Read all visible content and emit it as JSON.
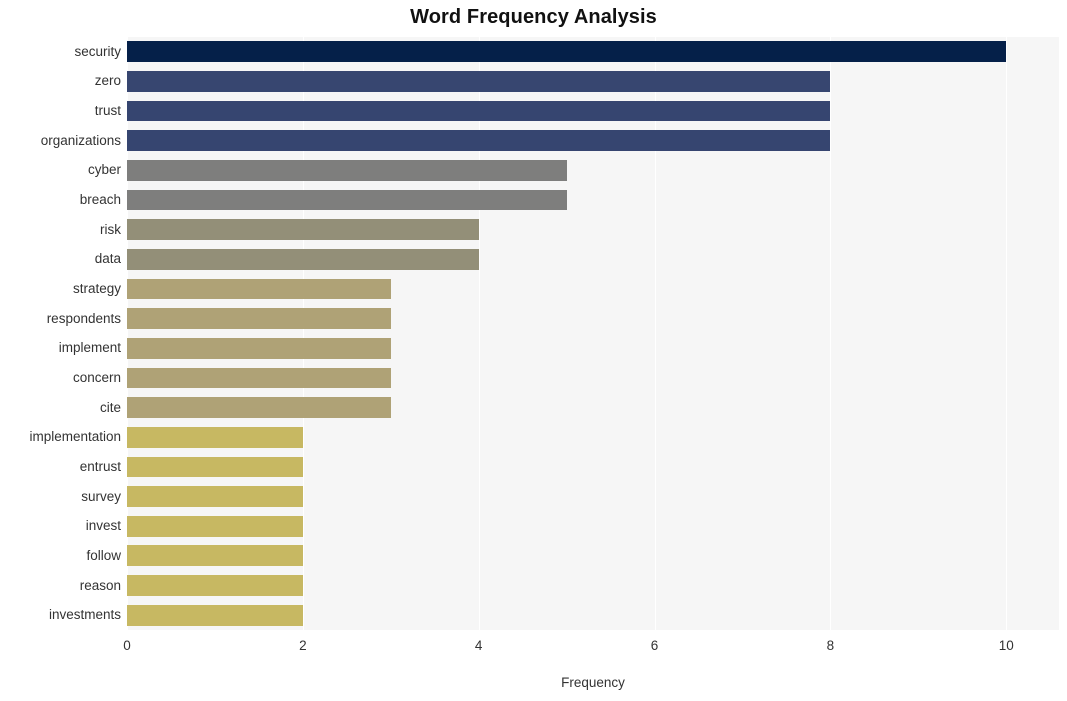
{
  "chart_data": {
    "type": "bar",
    "orientation": "horizontal",
    "title": "Word Frequency Analysis",
    "xlabel": "Frequency",
    "ylabel": "",
    "xlim": [
      0,
      10.6
    ],
    "ylim": null,
    "grid": true,
    "grid_color": "#ffffff",
    "plot_background": "#f6f6f6",
    "figure_background": "#ffffff",
    "legend": null,
    "legend_position": "none",
    "xticks": [
      0,
      2,
      4,
      6,
      8,
      10
    ],
    "xticklabels": [
      "0",
      "2",
      "4",
      "6",
      "8",
      "10"
    ],
    "categories": [
      "security",
      "zero",
      "trust",
      "organizations",
      "cyber",
      "breach",
      "risk",
      "data",
      "strategy",
      "respondents",
      "implement",
      "concern",
      "cite",
      "implementation",
      "entrust",
      "survey",
      "invest",
      "follow",
      "reason",
      "investments"
    ],
    "values": [
      10,
      8,
      8,
      8,
      5,
      5,
      4,
      4,
      3,
      3,
      3,
      3,
      3,
      2,
      2,
      2,
      2,
      2,
      2,
      2
    ],
    "bar_colors": [
      "#052049",
      "#374670",
      "#364570",
      "#364570",
      "#7e7e7d",
      "#7e7e7d",
      "#938f78",
      "#938f78",
      "#afa276",
      "#afa276",
      "#afa276",
      "#afa276",
      "#afa276",
      "#c7b862",
      "#c7b862",
      "#c7b862",
      "#c7b862",
      "#c7b862",
      "#c7b862",
      "#c7b862"
    ],
    "datapoints": [
      {
        "word": "security",
        "frequency": 10
      },
      {
        "word": "zero",
        "frequency": 8
      },
      {
        "word": "trust",
        "frequency": 8
      },
      {
        "word": "organizations",
        "frequency": 8
      },
      {
        "word": "cyber",
        "frequency": 5
      },
      {
        "word": "breach",
        "frequency": 5
      },
      {
        "word": "risk",
        "frequency": 4
      },
      {
        "word": "data",
        "frequency": 4
      },
      {
        "word": "strategy",
        "frequency": 3
      },
      {
        "word": "respondents",
        "frequency": 3
      },
      {
        "word": "implement",
        "frequency": 3
      },
      {
        "word": "concern",
        "frequency": 3
      },
      {
        "word": "cite",
        "frequency": 3
      },
      {
        "word": "implementation",
        "frequency": 2
      },
      {
        "word": "entrust",
        "frequency": 2
      },
      {
        "word": "survey",
        "frequency": 2
      },
      {
        "word": "invest",
        "frequency": 2
      },
      {
        "word": "follow",
        "frequency": 2
      },
      {
        "word": "reason",
        "frequency": 2
      },
      {
        "word": "investments",
        "frequency": 2
      }
    ]
  }
}
